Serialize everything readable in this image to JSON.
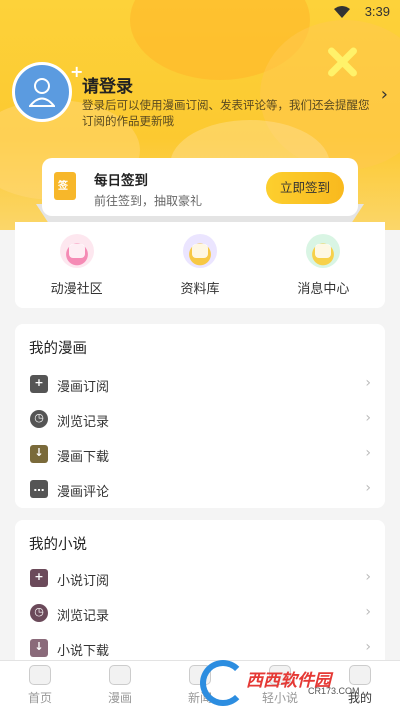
{
  "status_bar": {
    "time": "3:39"
  },
  "header": {
    "login_title": "请登录",
    "login_desc": "登录后可以使用漫画订阅、发表评论等，我们还会提醒您订阅的作品更新哦"
  },
  "checkin": {
    "title": "每日签到",
    "subtitle": "前往签到，抽取豪礼",
    "button": "立即签到",
    "icon_text": "签"
  },
  "quick_links": [
    {
      "label": "动漫社区",
      "icon": "community-icon"
    },
    {
      "label": "资料库",
      "icon": "library-icon"
    },
    {
      "label": "消息中心",
      "icon": "message-icon"
    }
  ],
  "comic_section": {
    "title": "我的漫画",
    "items": [
      {
        "label": "漫画订阅",
        "icon": "bookmark-icon",
        "glyph": "+"
      },
      {
        "label": "浏览记录",
        "icon": "clock-icon",
        "glyph": "◷"
      },
      {
        "label": "漫画下载",
        "icon": "download-icon",
        "glyph": "↓"
      },
      {
        "label": "漫画评论",
        "icon": "comment-icon",
        "glyph": "…"
      }
    ]
  },
  "novel_section": {
    "title": "我的小说",
    "items": [
      {
        "label": "小说订阅",
        "icon": "bookmark-icon",
        "glyph": "+"
      },
      {
        "label": "浏览记录",
        "icon": "clock-icon",
        "glyph": "◷"
      },
      {
        "label": "小说下载",
        "icon": "download-icon",
        "glyph": "↓"
      }
    ]
  },
  "bottom_nav": [
    {
      "label": "首页"
    },
    {
      "label": "漫画"
    },
    {
      "label": "新闻"
    },
    {
      "label": "轻小说"
    },
    {
      "label": "我的"
    }
  ],
  "watermark": {
    "text": "西西软件园",
    "sub": "CR173.COM"
  },
  "colors": {
    "accent": "#fcc930",
    "button": "#f9b91e",
    "avatar": "#5b9be0"
  }
}
